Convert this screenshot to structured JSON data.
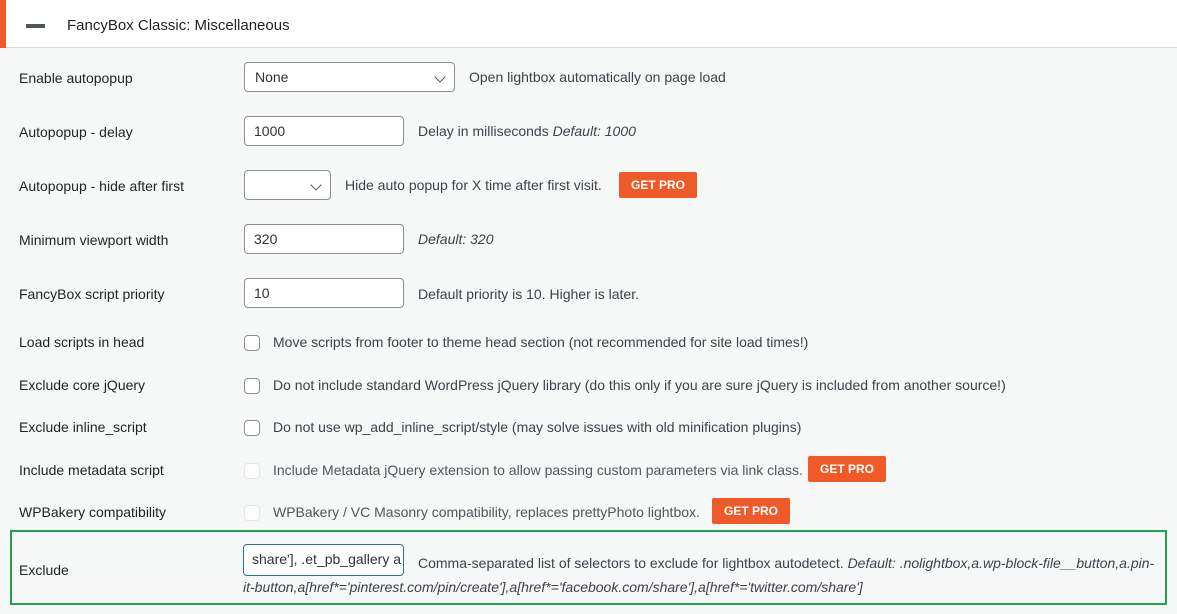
{
  "section": {
    "title": "FancyBox Classic: Miscellaneous"
  },
  "rows": {
    "autopopup": {
      "label": "Enable autopopup",
      "value": "None",
      "desc": "Open lightbox automatically on page load"
    },
    "delay": {
      "label": "Autopopup - delay",
      "value": "1000",
      "desc": "Delay in milliseconds",
      "default": "Default: 1000"
    },
    "hide": {
      "label": "Autopopup - hide after first",
      "value": "",
      "desc": "Hide auto popup for X time after first visit.",
      "pro": "GET PRO"
    },
    "viewport": {
      "label": "Minimum viewport width",
      "value": "320",
      "default": "Default: 320"
    },
    "priority": {
      "label": "FancyBox script priority",
      "value": "10",
      "desc": "Default priority is 10. Higher is later."
    },
    "head": {
      "label": "Load scripts in head",
      "desc": "Move scripts from footer to theme head section (not recommended for site load times!)"
    },
    "jquery": {
      "label": "Exclude core jQuery",
      "desc": "Do not include standard WordPress jQuery library (do this only if you are sure jQuery is included from another source!)"
    },
    "inline": {
      "label": "Exclude inline_script",
      "desc": "Do not use wp_add_inline_script/style (may solve issues with old minification plugins)"
    },
    "metadata": {
      "label": "Include metadata script",
      "desc": "Include Metadata jQuery extension to allow passing custom parameters via link class.",
      "pro": "GET PRO"
    },
    "wpbakery": {
      "label": "WPBakery compatibility",
      "desc": "WPBakery / VC Masonry compatibility, replaces prettyPhoto lightbox.",
      "pro": "GET PRO"
    },
    "exclude": {
      "label": "Exclude",
      "value": "share'], .et_pb_gallery a",
      "desc": "Comma-separated list of selectors to exclude for lightbox autodetect.",
      "default": "Default: .nolightbox,a.wp-block-file__button,a.pin-it-button,a[href*='pinterest.com/pin/create'],a[href*='facebook.com/share'],a[href*='twitter.com/share']"
    }
  },
  "colors": {
    "accent": "#f05a28",
    "highlight": "#22a04b",
    "focus": "#2271b1"
  }
}
